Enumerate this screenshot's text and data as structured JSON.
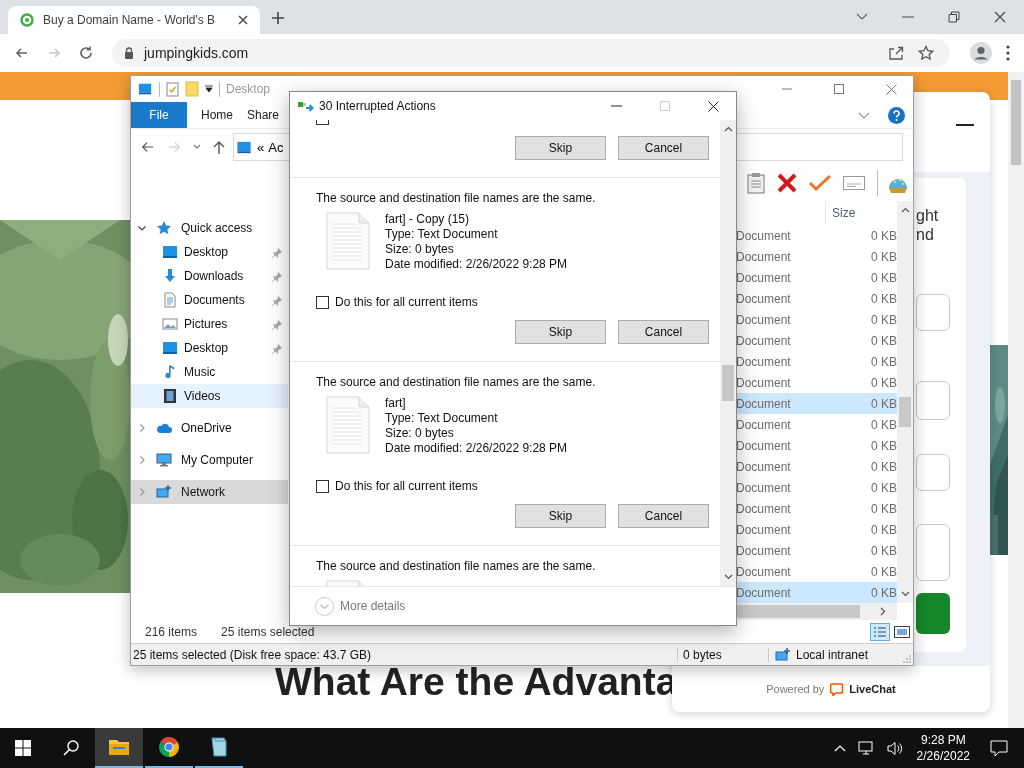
{
  "browser": {
    "tab": {
      "title": "Buy a Domain Name - World's B"
    },
    "nav_buttons": [
      {
        "kind": "back",
        "disabled": false
      },
      {
        "kind": "forward",
        "disabled": true
      },
      {
        "kind": "reload",
        "disabled": false
      }
    ],
    "address": "jumpingkids.com"
  },
  "webpage": {
    "heading_lines": [
      "What Are the Advanta"
    ],
    "chat": {
      "title_fragments": [
        "ght",
        "nd"
      ],
      "powered_by": "Powered by",
      "brand": "LiveChat"
    }
  },
  "explorer": {
    "title": "Desktop",
    "ribbon_tabs": [
      {
        "label": "File",
        "kind": "menu"
      },
      {
        "label": "Home",
        "kind": "tab"
      },
      {
        "label": "Share",
        "kind": "tab"
      }
    ],
    "address": {
      "overflow": "«",
      "path": "Ac"
    },
    "nav": [
      {
        "label": "Quick access",
        "kind": "star",
        "expanded": true,
        "selected": false,
        "hovered": false,
        "children": [
          {
            "label": "Desktop",
            "kind": "desktop",
            "pinned": true,
            "selected": false,
            "hovered": false
          },
          {
            "label": "Downloads",
            "kind": "download",
            "pinned": true,
            "selected": false,
            "hovered": false
          },
          {
            "label": "Documents",
            "kind": "documents",
            "pinned": true,
            "selected": false,
            "hovered": false
          },
          {
            "label": "Pictures",
            "kind": "pictures",
            "pinned": true,
            "selected": false,
            "hovered": false
          },
          {
            "label": "Desktop",
            "kind": "desktop",
            "pinned": true,
            "selected": false,
            "hovered": false
          },
          {
            "label": "Music",
            "kind": "music",
            "pinned": false,
            "selected": false,
            "hovered": false
          },
          {
            "label": "Videos",
            "kind": "videos",
            "pinned": false,
            "selected": false,
            "hovered": true
          }
        ]
      },
      {
        "label": "OneDrive",
        "kind": "cloud",
        "expanded": false,
        "selected": false,
        "hovered": false
      },
      {
        "label": "My Computer",
        "kind": "computer",
        "expanded": false,
        "selected": false,
        "hovered": false
      },
      {
        "label": "Network",
        "kind": "network",
        "expanded": false,
        "selected": true,
        "hovered": false
      }
    ],
    "size_column": "Size",
    "rows": [
      {
        "type": "Document",
        "size": "0 KB",
        "selected": false
      },
      {
        "type": "Document",
        "size": "0 KB",
        "selected": false
      },
      {
        "type": "Document",
        "size": "0 KB",
        "selected": false
      },
      {
        "type": "Document",
        "size": "0 KB",
        "selected": false
      },
      {
        "type": "Document",
        "size": "0 KB",
        "selected": false
      },
      {
        "type": "Document",
        "size": "0 KB",
        "selected": false
      },
      {
        "type": "Document",
        "size": "0 KB",
        "selected": false
      },
      {
        "type": "Document",
        "size": "0 KB",
        "selected": false
      },
      {
        "type": "Document",
        "size": "0 KB",
        "selected": true
      },
      {
        "type": "Document",
        "size": "0 KB",
        "selected": false
      },
      {
        "type": "Document",
        "size": "0 KB",
        "selected": false
      },
      {
        "type": "Document",
        "size": "0 KB",
        "selected": false
      },
      {
        "type": "Document",
        "size": "0 KB",
        "selected": false
      },
      {
        "type": "Document",
        "size": "0 KB",
        "selected": false
      },
      {
        "type": "Document",
        "size": "0 KB",
        "selected": false
      },
      {
        "type": "Document",
        "size": "0 KB",
        "selected": false
      },
      {
        "type": "Document",
        "size": "0 KB",
        "selected": false
      },
      {
        "type": "Document",
        "size": "0 KB",
        "selected": true
      }
    ],
    "status": {
      "item_count": "216 items",
      "selected_count": "25 items selected"
    },
    "details_bar": {
      "selection": "25 items selected (Disk free space: 43.7 GB)",
      "size": "0 bytes",
      "zone": "Local intranet"
    }
  },
  "dialog": {
    "title": "30 Interrupted Actions",
    "conflicts": [
      {
        "apply_all": {
          "checked": false
        },
        "buttons": [
          "Skip",
          "Cancel"
        ]
      },
      {
        "message": "The source and destination file names are the same.",
        "file": {
          "name": "fart] - Copy (15)",
          "type": "Type: Text Document",
          "size": "Size: 0 bytes",
          "date": "Date modified: 2/26/2022 9:28 PM"
        },
        "apply_all": {
          "label": "Do this for all current items",
          "checked": false
        },
        "buttons": [
          "Skip",
          "Cancel"
        ]
      },
      {
        "message": "The source and destination file names are the same.",
        "file": {
          "name": "fart]",
          "type": "Type: Text Document",
          "size": "Size: 0 bytes",
          "date": "Date modified: 2/26/2022 9:28 PM"
        },
        "apply_all": {
          "label": "Do this for all current items",
          "checked": false
        },
        "buttons": [
          "Skip",
          "Cancel"
        ]
      },
      {
        "message": "The source and destination file names are the same.",
        "file": {
          "kind": "text"
        }
      }
    ],
    "more_details": "More details"
  },
  "taskbar": {
    "apps": [
      {
        "kind": "folder",
        "active": true
      },
      {
        "kind": "browser",
        "active": false
      },
      {
        "kind": "notepad",
        "active": false
      }
    ],
    "time": "9:28 PM",
    "date": "2/26/2022"
  }
}
